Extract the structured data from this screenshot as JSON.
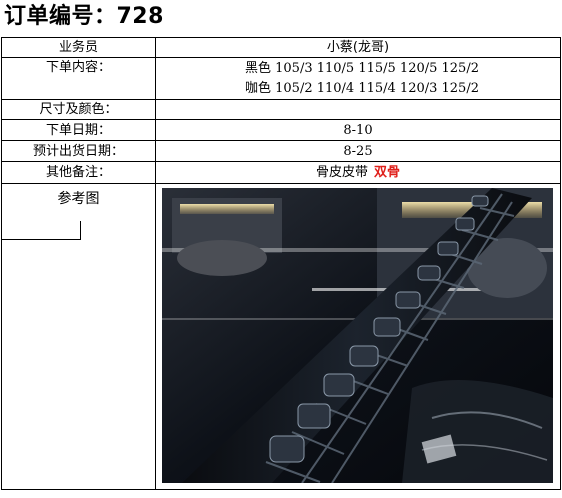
{
  "title": "订单编号：728",
  "rows": {
    "salesperson": {
      "label": "业务员",
      "value": "小蔡(龙哥)"
    },
    "order_content": {
      "label": "下单内容：",
      "lines": [
        "黑色 105/3 110/5 115/5 120/5 125/2",
        "咖色 105/2 110/4 115/4 120/3 125/2"
      ]
    },
    "size_color": {
      "label": "尺寸及颜色：",
      "value": ""
    },
    "order_date": {
      "label": "下单日期：",
      "value": "8-10"
    },
    "ship_date": {
      "label": "预计出货日期：",
      "value": "8-25"
    },
    "remarks": {
      "label": "其他备注：",
      "value": "骨皮皮带",
      "highlight": "双骨"
    },
    "reference": {
      "label": "参考图"
    }
  },
  "colors": {
    "highlight": "#e0201b",
    "border": "#000000"
  },
  "photo": {
    "subject": "black crocodile-bone leather belt strap in display case"
  }
}
